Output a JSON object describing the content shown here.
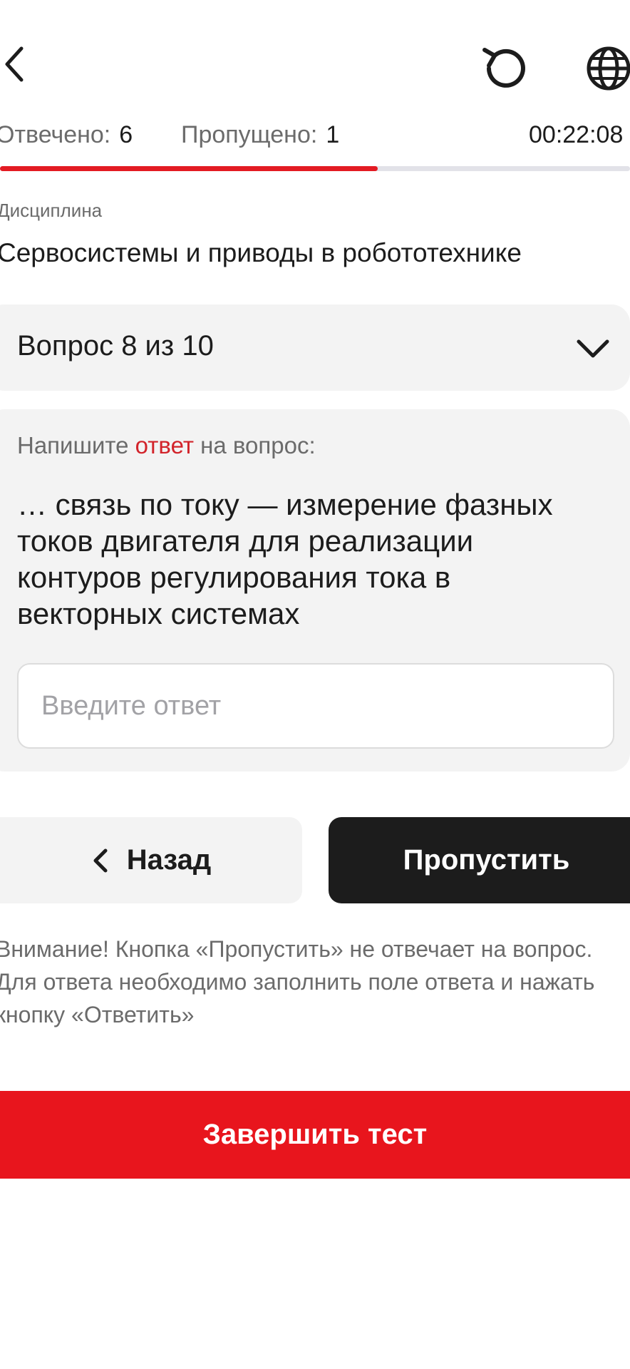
{
  "header": {
    "back_icon": "chevron-left-icon",
    "reload_icon": "reload-icon",
    "language_icon": "globe-icon"
  },
  "stats": {
    "answered_label": "Отвечено:",
    "answered_value": "6",
    "skipped_label": "Пропущено:",
    "skipped_value": "1",
    "timer": "00:22:08"
  },
  "progress": {
    "fraction": 0.6
  },
  "discipline": {
    "label": "Дисциплина",
    "value": "Сервосистемы и приводы в робототехнике"
  },
  "question_selector": {
    "label": "Вопрос 8 из 10",
    "icon": "chevron-down-icon"
  },
  "question": {
    "prompt_before": "Напишите ",
    "prompt_highlight": "ответ",
    "prompt_after": " на вопрос:",
    "text": "… связь по току — измерение фазных токов двигателя для реализации контуров регулирования тока в векторных системах",
    "answer_value": "",
    "answer_placeholder": "Введите ответ"
  },
  "buttons": {
    "back_label": "Назад",
    "skip_label": "Пропустить",
    "finish_label": "Завершить тест"
  },
  "notice": "Внимание! Кнопка «Пропустить» не отвечает на вопрос. Для ответа необходимо заполнить поле ответа и нажать кнопку «Ответить»",
  "colors": {
    "accent_red": "#e8151d",
    "dark": "#1c1c1c",
    "muted": "#6b6b6b",
    "card_bg": "#f3f3f3"
  }
}
